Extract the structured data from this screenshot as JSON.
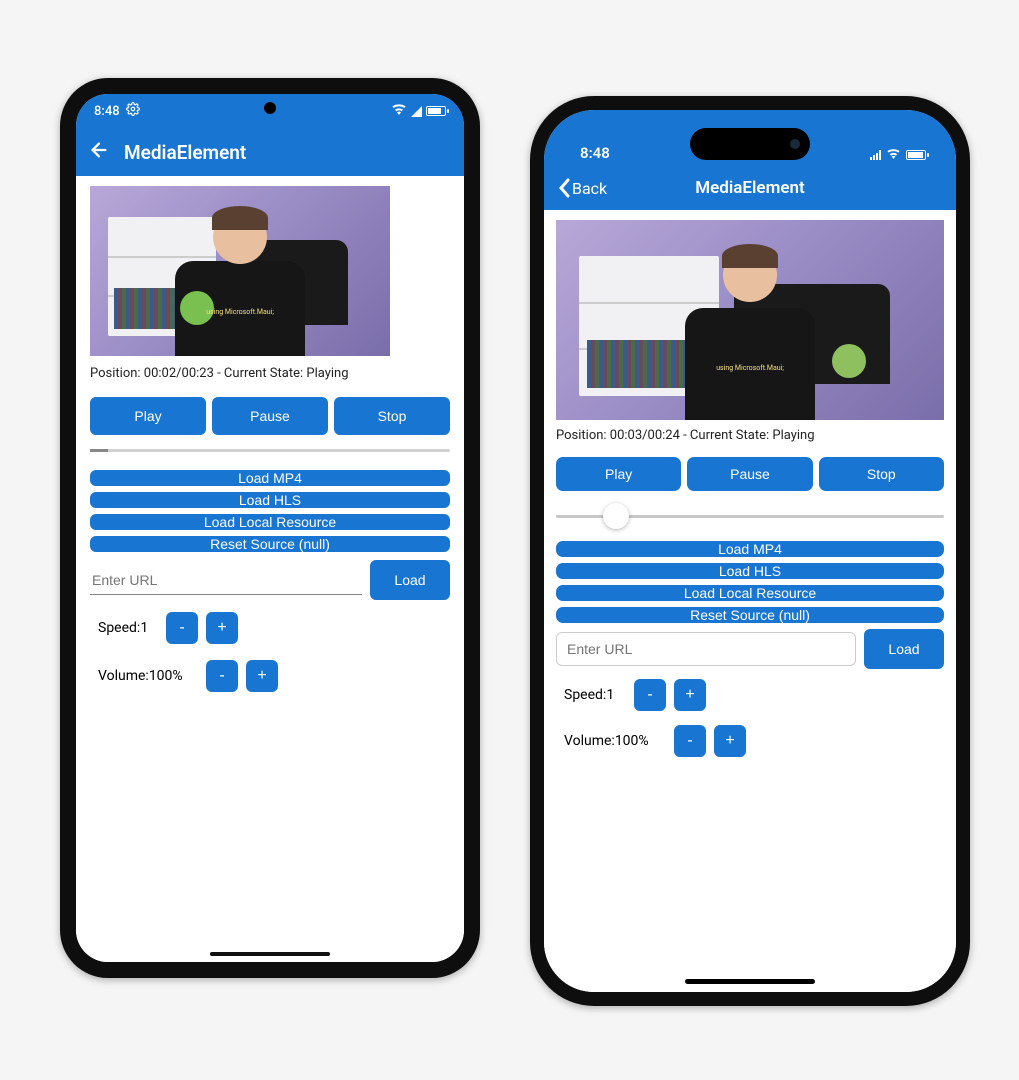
{
  "android": {
    "status_time": "8:48",
    "app_title": "MediaElement",
    "shirt_text": "using Microsoft.Maui;",
    "position_line": "Position: 00:02/00:23 - Current State: Playing",
    "buttons": {
      "play": "Play",
      "pause": "Pause",
      "stop": "Stop"
    },
    "loaders": {
      "mp4": "Load MP4",
      "hls": "Load HLS",
      "local": "Load Local Resource",
      "reset": "Reset Source (null)"
    },
    "url_placeholder": "Enter URL",
    "load_label": "Load",
    "speed": {
      "label": "Speed:",
      "value": "1",
      "minus": "-",
      "plus": "+"
    },
    "volume": {
      "label": "Volume:",
      "value": "100%",
      "minus": "-",
      "plus": "+"
    }
  },
  "ios": {
    "status_time": "8:48",
    "back_label": "Back",
    "app_title": "MediaElement",
    "shirt_text": "using Microsoft.Maui;",
    "position_line": "Position: 00:03/00:24 - Current State: Playing",
    "buttons": {
      "play": "Play",
      "pause": "Pause",
      "stop": "Stop"
    },
    "loaders": {
      "mp4": "Load MP4",
      "hls": "Load HLS",
      "local": "Load Local Resource",
      "reset": "Reset Source (null)"
    },
    "url_placeholder": "Enter URL",
    "load_label": "Load",
    "speed": {
      "label": "Speed:",
      "value": "1",
      "minus": "-",
      "plus": "+"
    },
    "volume": {
      "label": "Volume:",
      "value": "100%",
      "minus": "-",
      "plus": "+"
    }
  }
}
